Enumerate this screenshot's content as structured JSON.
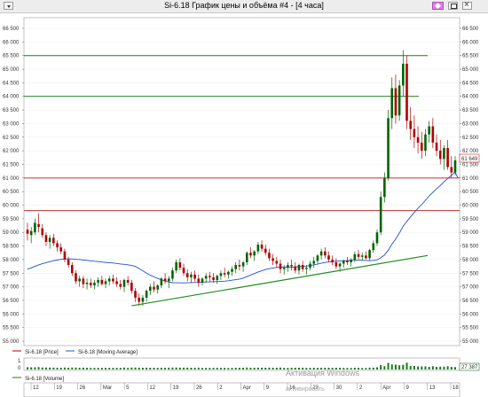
{
  "window": {
    "title": "Si-6.18 График цены и объёма #4 - [4 часа]"
  },
  "colors": {
    "up": "#006400",
    "down": "#b00000",
    "ma": "#2050d0",
    "hline_green": "#1f7a1f",
    "hline_red": "#c03030",
    "trend": "#1e8f1e",
    "volume": "#1a7a1a",
    "price_tag_bg": "#ffffff"
  },
  "price_axis": {
    "labels": [
      "66 500",
      "66 000",
      "65 500",
      "65 000",
      "64 500",
      "64 000",
      "63 500",
      "63 000",
      "62 500",
      "62 000",
      "61 500",
      "61 000",
      "60 500",
      "60 000",
      "59 500",
      "59 000",
      "58 500",
      "58 000",
      "57 500",
      "57 000",
      "56 500",
      "56 000",
      "55 500",
      "55 000"
    ],
    "min": 55000,
    "max": 66500,
    "last_price_tag": "61 649"
  },
  "legend": {
    "price": "Si-6.18 [Price]",
    "ma": "Si-6.18 [Moving Average]",
    "volume": "Si-6.18 [Volume]"
  },
  "volume_axis": {
    "labels": [
      "0",
      "1"
    ],
    "last_volume_tag": "27 387"
  },
  "time_axis": {
    "labels": [
      "12",
      "19",
      "26",
      "Mar",
      "5",
      "12",
      "19",
      "26",
      "2",
      "Apr",
      "9",
      "16",
      "23",
      "30",
      "2",
      "Apr",
      "9",
      "13",
      "18"
    ]
  },
  "watermark": {
    "line1": "Активация Windows",
    "line2": "активировать"
  },
  "chart_data": {
    "type": "candlestick",
    "ylim": [
      55000,
      66500
    ],
    "candles_ohlc": [
      [
        59100,
        59350,
        58700,
        58950
      ],
      [
        58900,
        59200,
        58600,
        59050
      ],
      [
        59000,
        59500,
        58900,
        59350
      ],
      [
        59300,
        59700,
        59000,
        59200
      ],
      [
        59150,
        59300,
        58800,
        58900
      ],
      [
        58900,
        59000,
        58500,
        58650
      ],
      [
        58650,
        58900,
        58400,
        58800
      ],
      [
        58800,
        58950,
        58500,
        58600
      ],
      [
        58600,
        58700,
        58300,
        58450
      ],
      [
        58450,
        58600,
        58200,
        58300
      ],
      [
        58300,
        58400,
        57900,
        58000
      ],
      [
        58000,
        58100,
        57700,
        57800
      ],
      [
        57800,
        57900,
        57400,
        57500
      ],
      [
        57500,
        57600,
        57100,
        57200
      ],
      [
        57200,
        57400,
        57000,
        57300
      ],
      [
        57300,
        57400,
        56950,
        57100
      ],
      [
        57100,
        57300,
        56900,
        57150
      ],
      [
        57150,
        57300,
        56950,
        57050
      ],
      [
        57050,
        57250,
        56900,
        57150
      ],
      [
        57150,
        57350,
        57000,
        57250
      ],
      [
        57250,
        57400,
        57050,
        57100
      ],
      [
        57100,
        57300,
        56950,
        57200
      ],
      [
        57200,
        57400,
        57050,
        57300
      ],
      [
        57300,
        57450,
        57100,
        57200
      ],
      [
        57200,
        57350,
        57000,
        57100
      ],
      [
        57100,
        57250,
        56900,
        57000
      ],
      [
        57000,
        57300,
        56800,
        57250
      ],
      [
        57250,
        57400,
        57050,
        57150
      ],
      [
        57150,
        57250,
        56750,
        56850
      ],
      [
        56850,
        56950,
        56450,
        56600
      ],
      [
        56600,
        56750,
        56300,
        56450
      ],
      [
        56450,
        56700,
        56300,
        56600
      ],
      [
        56600,
        56900,
        56450,
        56850
      ],
      [
        56850,
        57100,
        56700,
        57000
      ],
      [
        57000,
        57200,
        56800,
        56900
      ],
      [
        56900,
        57100,
        56750,
        57050
      ],
      [
        57050,
        57350,
        56950,
        57300
      ],
      [
        57300,
        57500,
        57100,
        57200
      ],
      [
        57200,
        57400,
        56950,
        57300
      ],
      [
        57300,
        57700,
        57200,
        57600
      ],
      [
        57600,
        58000,
        57500,
        57900
      ],
      [
        57900,
        58050,
        57600,
        57700
      ],
      [
        57700,
        57850,
        57400,
        57500
      ],
      [
        57500,
        57650,
        57200,
        57350
      ],
      [
        57350,
        57550,
        57150,
        57450
      ],
      [
        57450,
        57600,
        57200,
        57300
      ],
      [
        57300,
        57450,
        57000,
        57150
      ],
      [
        57150,
        57350,
        57050,
        57300
      ],
      [
        57300,
        57500,
        57150,
        57400
      ],
      [
        57400,
        57550,
        57200,
        57350
      ],
      [
        57350,
        57500,
        57150,
        57250
      ],
      [
        57250,
        57450,
        57100,
        57400
      ],
      [
        57400,
        57600,
        57250,
        57500
      ],
      [
        57500,
        57700,
        57350,
        57450
      ],
      [
        57450,
        57600,
        57300,
        57550
      ],
      [
        57550,
        57750,
        57400,
        57650
      ],
      [
        57650,
        57900,
        57500,
        57800
      ],
      [
        57800,
        58000,
        57600,
        57750
      ],
      [
        57750,
        57950,
        57550,
        57900
      ],
      [
        57900,
        58300,
        57800,
        58250
      ],
      [
        58250,
        58450,
        58050,
        58150
      ],
      [
        58150,
        58350,
        57950,
        58300
      ],
      [
        58300,
        58650,
        58200,
        58550
      ],
      [
        58550,
        58700,
        58300,
        58400
      ],
      [
        58400,
        58550,
        58150,
        58250
      ],
      [
        58250,
        58400,
        57950,
        58050
      ],
      [
        58050,
        58200,
        57800,
        57950
      ],
      [
        57950,
        58100,
        57700,
        57850
      ],
      [
        57850,
        58000,
        57500,
        57650
      ],
      [
        57650,
        57800,
        57450,
        57700
      ],
      [
        57700,
        57900,
        57550,
        57800
      ],
      [
        57800,
        58000,
        57600,
        57750
      ],
      [
        57750,
        57900,
        57500,
        57600
      ],
      [
        57600,
        57850,
        57450,
        57800
      ],
      [
        57800,
        57950,
        57550,
        57650
      ],
      [
        57650,
        57800,
        57450,
        57700
      ],
      [
        57700,
        57950,
        57600,
        57850
      ],
      [
        57850,
        58100,
        57700,
        57950
      ],
      [
        57950,
        58200,
        57850,
        58150
      ],
      [
        58150,
        58400,
        58000,
        58300
      ],
      [
        58300,
        58450,
        58050,
        58150
      ],
      [
        58150,
        58300,
        57900,
        58000
      ],
      [
        58000,
        58150,
        57800,
        57900
      ],
      [
        57900,
        58050,
        57650,
        57750
      ],
      [
        57750,
        57900,
        57550,
        57850
      ],
      [
        57850,
        58000,
        57700,
        57950
      ],
      [
        57950,
        58100,
        57800,
        57900
      ],
      [
        57900,
        58050,
        57750,
        58000
      ],
      [
        58000,
        58300,
        57900,
        58200
      ],
      [
        58200,
        58350,
        58000,
        58100
      ],
      [
        58100,
        58250,
        57950,
        58150
      ],
      [
        58150,
        58300,
        58000,
        58050
      ],
      [
        58050,
        58400,
        57950,
        58350
      ],
      [
        58350,
        58700,
        58250,
        58600
      ],
      [
        58600,
        59100,
        58500,
        59000
      ],
      [
        59000,
        60500,
        58900,
        60300
      ],
      [
        60300,
        61200,
        60100,
        61000
      ],
      [
        61000,
        63500,
        60900,
        63200
      ],
      [
        63200,
        64700,
        62800,
        64300
      ],
      [
        64300,
        64800,
        63000,
        63300
      ],
      [
        63300,
        64600,
        63100,
        64400
      ],
      [
        64400,
        65700,
        64000,
        65200
      ],
      [
        65200,
        65500,
        62800,
        63100
      ],
      [
        63100,
        63600,
        62400,
        62800
      ],
      [
        62800,
        63300,
        62100,
        62500
      ],
      [
        62500,
        62900,
        61900,
        62300
      ],
      [
        62300,
        62700,
        61700,
        62000
      ],
      [
        62000,
        62800,
        61800,
        62600
      ],
      [
        62600,
        63100,
        62300,
        62900
      ],
      [
        62900,
        63200,
        62100,
        62300
      ],
      [
        62300,
        62600,
        61800,
        62000
      ],
      [
        62000,
        62400,
        61500,
        61700
      ],
      [
        61700,
        62200,
        61300,
        62100
      ],
      [
        62100,
        62400,
        61300,
        61400
      ],
      [
        61400,
        61800,
        61000,
        61200
      ],
      [
        61200,
        61800,
        61100,
        61649
      ]
    ],
    "moving_average_endpoints": {
      "start": 57600,
      "min_level": 57150,
      "end": 61000
    },
    "horizontal_levels": {
      "green": [
        65500,
        64000
      ],
      "red": [
        61000,
        59800
      ]
    },
    "trendline": {
      "from_price": 56300,
      "to_price": 58150
    }
  }
}
